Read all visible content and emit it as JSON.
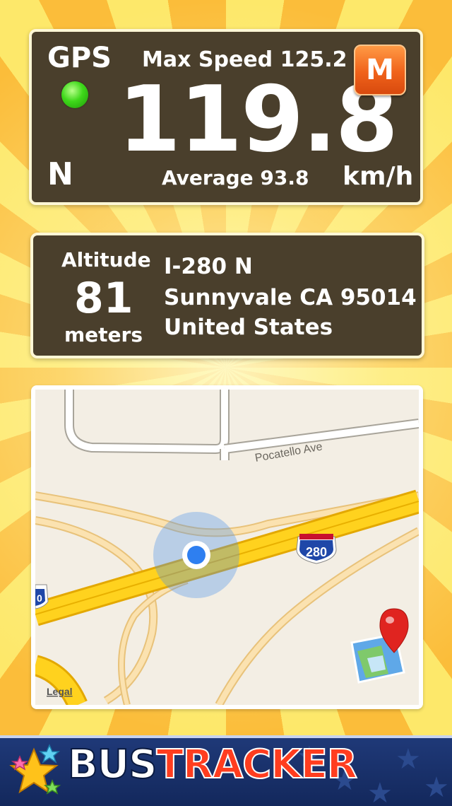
{
  "speed_panel": {
    "gps_label": "GPS",
    "gps_status_color": "#3ed81a",
    "heading": "N",
    "max_speed": "Max Speed 125.2",
    "current_speed": "119.8",
    "average": "Average 93.8",
    "units": "km/h",
    "mode_button_label": "M"
  },
  "info_panel": {
    "altitude_label": "Altitude",
    "altitude_value": "81",
    "altitude_units": "meters",
    "address_line1": "I-280 N",
    "address_line2": "Sunnyvale CA 95014",
    "address_line3": "United States"
  },
  "map": {
    "street_name": "Pocatello Ave",
    "highway_shield": "280",
    "highway_shield_partial": "0",
    "legal_label": "Legal",
    "open_maps_icon": "map-pin-icon",
    "location_icon": "current-location-icon",
    "colors": {
      "land": "#f3eee4",
      "highway": "#ffd21e",
      "road": "#f6d9a2",
      "location": "#2e7ff0",
      "shield": "#1f47a8"
    }
  },
  "footer": {
    "logo_bus": "BUS",
    "logo_tracker": "TRACKER",
    "logo_icon": "star-cluster-icon"
  }
}
